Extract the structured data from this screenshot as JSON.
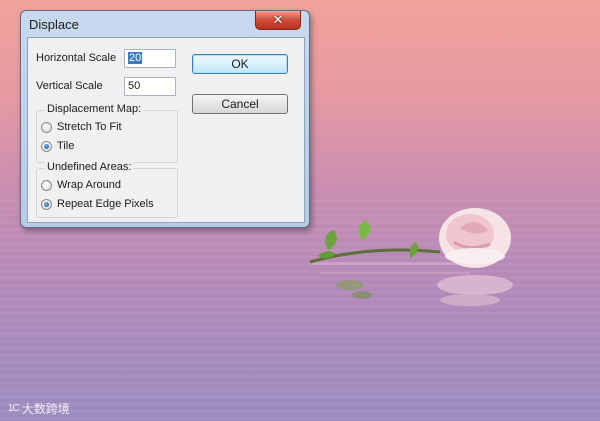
{
  "dialog": {
    "title": "Displace",
    "close_glyph": "✕",
    "horizontal_scale_label": "Horizontal Scale",
    "horizontal_scale_value": "20",
    "vertical_scale_label": "Vertical Scale",
    "vertical_scale_value": "50",
    "displacement_map": {
      "title": "Displacement Map:",
      "options": [
        {
          "label": "Stretch To Fit",
          "selected": false
        },
        {
          "label": "Tile",
          "selected": true
        }
      ]
    },
    "undefined_areas": {
      "title": "Undefined Areas:",
      "options": [
        {
          "label": "Wrap Around",
          "selected": false
        },
        {
          "label": "Repeat Edge Pixels",
          "selected": true
        }
      ]
    },
    "ok_label": "OK",
    "cancel_label": "Cancel"
  },
  "watermark": {
    "logo": "1C",
    "text": "大数跨境"
  },
  "colors": {
    "accent_selection": "#3a78c9",
    "close_red": "#cf4c39",
    "sky_top": "#f0a39a",
    "water_bottom": "#9c8cbf"
  }
}
